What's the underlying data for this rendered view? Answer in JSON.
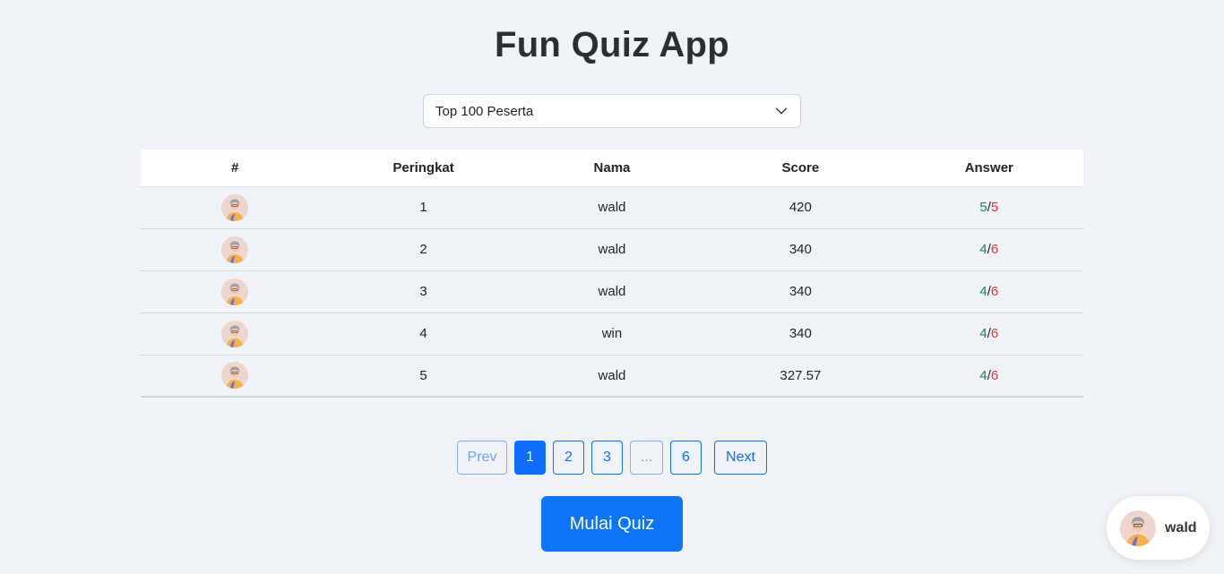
{
  "app": {
    "title": "Fun Quiz App"
  },
  "filter": {
    "selected": "Top 100 Peserta"
  },
  "table": {
    "headers": [
      "#",
      "Peringkat",
      "Nama",
      "Score",
      "Answer"
    ],
    "rows": [
      {
        "rank": "1",
        "name": "wald",
        "score": "420",
        "correct": "5",
        "total": "5"
      },
      {
        "rank": "2",
        "name": "wald",
        "score": "340",
        "correct": "4",
        "total": "6"
      },
      {
        "rank": "3",
        "name": "wald",
        "score": "340",
        "correct": "4",
        "total": "6"
      },
      {
        "rank": "4",
        "name": "win",
        "score": "340",
        "correct": "4",
        "total": "6"
      },
      {
        "rank": "5",
        "name": "wald",
        "score": "327.57",
        "correct": "4",
        "total": "6"
      }
    ]
  },
  "pagination": {
    "prev": "Prev",
    "pages": [
      "1",
      "2",
      "3",
      "...",
      "6"
    ],
    "next": "Next",
    "current": "1"
  },
  "actions": {
    "start": "Mulai Quiz"
  },
  "user": {
    "name": "wald"
  },
  "colors": {
    "primary": "#0d6efd",
    "correct": "#198754",
    "wrong": "#dc3545",
    "background": "#eff2f7"
  },
  "icons": {
    "avatar": "user-avatar-icon",
    "dropdown": "chevron-down-icon"
  }
}
